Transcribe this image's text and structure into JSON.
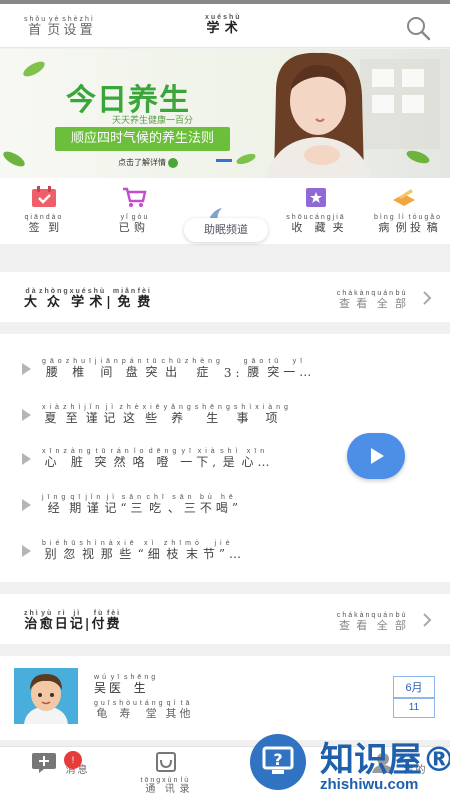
{
  "header": {
    "left_chars": [
      {
        "c": "首",
        "p": "shǒu"
      },
      {
        "c": "页",
        "p": "yè"
      },
      {
        "c": "设",
        "p": "shè"
      },
      {
        "c": "置",
        "p": "zhì"
      }
    ],
    "title_chars": [
      {
        "c": "学",
        "p": "xué"
      },
      {
        "c": "术",
        "p": "shù"
      }
    ],
    "search_icon": "search-icon"
  },
  "banner": {
    "title": "今日养生",
    "subtitle": "天天养生健康一百分",
    "ribbon": "顺应四时气候的养生法则",
    "more": "点击了解详情"
  },
  "quick_menu": {
    "items": [
      {
        "icon": "checkin-icon",
        "chars": [
          {
            "c": "签",
            "p": "qiān"
          },
          {
            "c": "到",
            "p": "dào"
          }
        ]
      },
      {
        "icon": "cart-icon",
        "chars": [
          {
            "c": "已",
            "p": "yǐ"
          },
          {
            "c": "购",
            "p": "gòu"
          }
        ]
      },
      {
        "icon": "favorite-icon",
        "chars": [
          {
            "c": "收",
            "p": "shōu"
          },
          {
            "c": "藏",
            "p": "cáng"
          },
          {
            "c": "夹",
            "p": "jiā"
          }
        ]
      },
      {
        "icon": "submit-case-icon",
        "chars": [
          {
            "c": "病",
            "p": "bìng"
          },
          {
            "c": "例",
            "p": "lì"
          },
          {
            "c": "投",
            "p": "tóu"
          },
          {
            "c": "稿",
            "p": "gǎo"
          }
        ]
      }
    ],
    "center_label": "助眠频道"
  },
  "section1": {
    "title_chars": [
      {
        "c": "大",
        "p": "dà"
      },
      {
        "c": "众",
        "p": "zhòng"
      },
      {
        "c": "学",
        "p": "xué"
      },
      {
        "c": "术",
        "p": "shù"
      },
      {
        "c": "|",
        "p": ""
      },
      {
        "c": "免",
        "p": "miǎn"
      },
      {
        "c": "费",
        "p": "fèi"
      }
    ],
    "more_chars": [
      {
        "c": "查",
        "p": "chá"
      },
      {
        "c": "看",
        "p": "kàn"
      },
      {
        "c": "全",
        "p": "quán"
      },
      {
        "c": "部",
        "p": "bù"
      }
    ]
  },
  "articles": [
    {
      "chars": [
        {
          "c": "腰",
          "p": "gāo"
        },
        {
          "c": "椎",
          "p": "zhuī"
        },
        {
          "c": "间",
          "p": "jiān"
        },
        {
          "c": "盘",
          "p": "pán"
        },
        {
          "c": "突",
          "p": "tū"
        },
        {
          "c": "出",
          "p": "chū"
        },
        {
          "c": "症",
          "p": "zhèng"
        },
        {
          "c": "3:",
          "p": ""
        },
        {
          "c": "腰",
          "p": "gāo"
        },
        {
          "c": "突",
          "p": "tū"
        },
        {
          "c": "一…",
          "p": "yī"
        }
      ]
    },
    {
      "chars": [
        {
          "c": "夏",
          "p": "xià"
        },
        {
          "c": "至",
          "p": "zhì"
        },
        {
          "c": "谨",
          "p": "jǐn"
        },
        {
          "c": "记",
          "p": "jì"
        },
        {
          "c": "这",
          "p": "zhè"
        },
        {
          "c": "些",
          "p": "xiē"
        },
        {
          "c": "养",
          "p": "yǎng"
        },
        {
          "c": "生",
          "p": "shēng"
        },
        {
          "c": "事",
          "p": "shì"
        },
        {
          "c": "项",
          "p": "xiàng"
        }
      ]
    },
    {
      "chars": [
        {
          "c": "心",
          "p": "xīn"
        },
        {
          "c": "脏",
          "p": "zàng"
        },
        {
          "c": "突",
          "p": "tū"
        },
        {
          "c": "然",
          "p": "rán"
        },
        {
          "c": "咯",
          "p": "lo"
        },
        {
          "c": "噔",
          "p": "dēng"
        },
        {
          "c": "一",
          "p": "yī"
        },
        {
          "c": "下,",
          "p": "xià"
        },
        {
          "c": "是",
          "p": "shì"
        },
        {
          "c": "心…",
          "p": "xīn"
        }
      ]
    },
    {
      "chars": [
        {
          "c": "经",
          "p": "jīng"
        },
        {
          "c": "期",
          "p": "qī"
        },
        {
          "c": "谨",
          "p": "jǐn"
        },
        {
          "c": "记",
          "p": "jì"
        },
        {
          "c": "“三",
          "p": "sān"
        },
        {
          "c": "吃",
          "p": "chī"
        },
        {
          "c": "、三",
          "p": "sān"
        },
        {
          "c": "不",
          "p": "bù"
        },
        {
          "c": "喝”",
          "p": "hē"
        }
      ]
    },
    {
      "chars": [
        {
          "c": "别",
          "p": "bié"
        },
        {
          "c": "忽",
          "p": "hū"
        },
        {
          "c": "视",
          "p": "shì"
        },
        {
          "c": "那",
          "p": "nà"
        },
        {
          "c": "些",
          "p": "xiē"
        },
        {
          "c": "“细",
          "p": "xì"
        },
        {
          "c": "枝",
          "p": "zhī"
        },
        {
          "c": "末",
          "p": "mò"
        },
        {
          "c": "节”…",
          "p": "jié"
        }
      ]
    }
  ],
  "section2": {
    "title_chars": [
      {
        "c": "治",
        "p": "zhì"
      },
      {
        "c": "愈",
        "p": "yù"
      },
      {
        "c": "日",
        "p": "rì"
      },
      {
        "c": "记",
        "p": "jì"
      },
      {
        "c": "|",
        "p": ""
      },
      {
        "c": "付",
        "p": "fù"
      },
      {
        "c": "费",
        "p": "fèi"
      }
    ],
    "more_chars": [
      {
        "c": "查",
        "p": "chá"
      },
      {
        "c": "看",
        "p": "kàn"
      },
      {
        "c": "全",
        "p": "quán"
      },
      {
        "c": "部",
        "p": "bù"
      }
    ]
  },
  "doctor": {
    "name_chars": [
      {
        "c": "吴",
        "p": "wú"
      },
      {
        "c": "医",
        "p": "yī"
      },
      {
        "c": "生",
        "p": "shēng"
      }
    ],
    "place_chars": [
      {
        "c": "龟",
        "p": "guī"
      },
      {
        "c": "寿",
        "p": "shòu"
      },
      {
        "c": "堂",
        "p": "táng"
      },
      {
        "c": "其",
        "p": "qí"
      },
      {
        "c": "他",
        "p": "tā"
      }
    ],
    "calendar": {
      "month": "6月",
      "month_pinyin": "yuè",
      "day": "11"
    }
  },
  "tabbar": {
    "items": [
      {
        "icon": "message-icon",
        "chars": [
          {
            "c": "消",
            "p": ""
          },
          {
            "c": "息",
            "p": ""
          }
        ],
        "badge": "!"
      },
      {
        "icon": "contacts-icon",
        "chars": [
          {
            "c": "通",
            "p": "tōng"
          },
          {
            "c": "讯",
            "p": "xùn"
          },
          {
            "c": "录",
            "p": "lù"
          }
        ]
      },
      {
        "icon": "profile-icon",
        "chars": [
          {
            "c": "我",
            "p": ""
          },
          {
            "c": "的",
            "p": ""
          }
        ]
      }
    ]
  },
  "watermark": {
    "brand": "知识屋®",
    "url": "zhishiwu.com"
  },
  "colors": {
    "accent_blue": "#4d8ee6",
    "banner_green": "#3aa63a",
    "badge_red": "#e63b3b",
    "watermark_blue": "#1e5fae"
  }
}
